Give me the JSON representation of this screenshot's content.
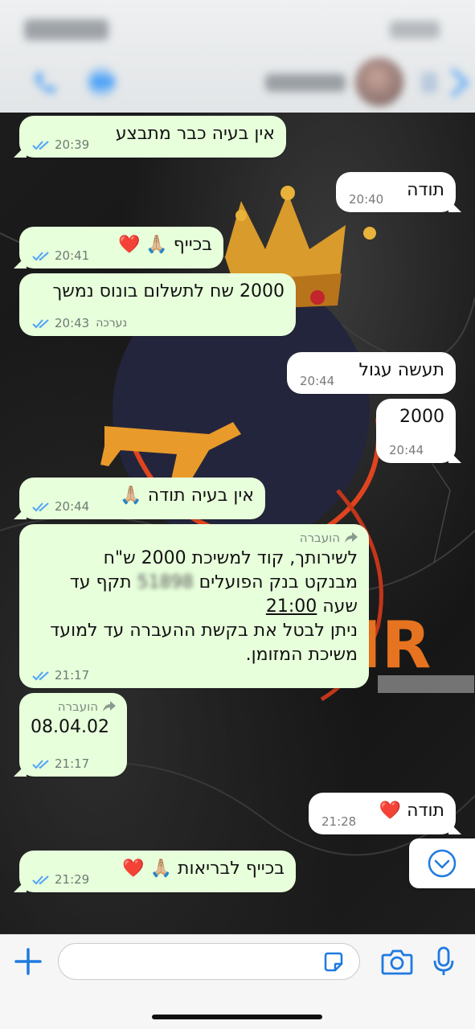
{
  "header": {
    "contact_name": "██████",
    "status": "████"
  },
  "messages": [
    {
      "text": "אין בעיה כבר מתבצע",
      "time": "20:39"
    },
    {
      "text": "תודה",
      "time": "20:40"
    },
    {
      "text": "בכייף 🙏🏼",
      "emoji": "❤️",
      "time": "20:41"
    },
    {
      "text": "2000 שח לתשלום בונוס נמשך",
      "time": "20:43",
      "edited": "נערכה"
    },
    {
      "text": "תעשה עגול",
      "time": "20:44"
    },
    {
      "text": "2000",
      "time": "20:44"
    },
    {
      "text": "אין בעיה תודה 🙏🏼",
      "time": "20:44"
    },
    {
      "forwarded": "הועברה",
      "line1": "לשירותך, קוד למשיכת 2000 ש\"ח",
      "line2a": "מבנקט בנק הפועלים",
      "line2_blurred": "51898",
      "line2b": "תקף עד",
      "line3a": "שעה",
      "line3_time": "21:00",
      "line4": "ניתן לבטל את בקשת ההעברה עד למועד",
      "line5": "משיכת המזומן.",
      "time": "21:17"
    },
    {
      "forwarded": "הועברה",
      "text": "08.04.02",
      "time": "21:17"
    },
    {
      "text": "תודה",
      "emoji": "❤️",
      "time": "21:28"
    },
    {
      "text": "בכייף לבריאות 🙏🏼",
      "emoji": "❤️",
      "time": "21:29"
    }
  ],
  "colors": {
    "outgoing": "#e7ffdb",
    "incoming": "#ffffff",
    "accent": "#1f7ae0",
    "ticks": "#4fa3f7"
  },
  "icons": [
    "back-icon",
    "phone-icon",
    "video-icon",
    "avatar",
    "double-check-icon",
    "forward-icon",
    "chevron-down-icon",
    "plus-icon",
    "sticker-icon",
    "camera-icon",
    "mic-icon"
  ]
}
